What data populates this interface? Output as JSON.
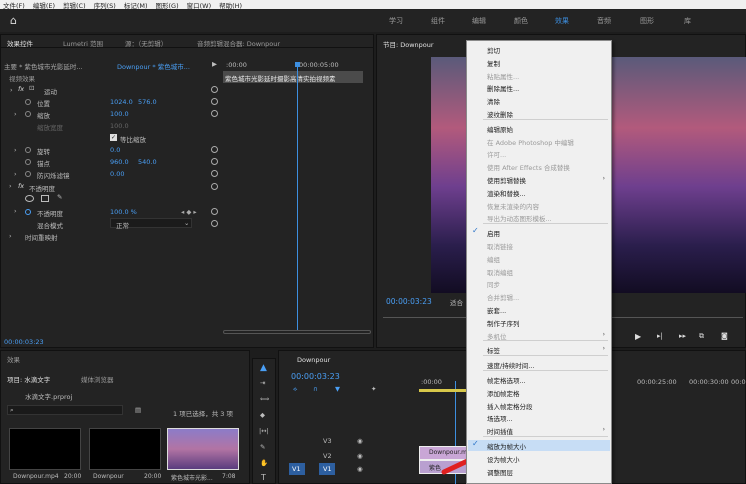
{
  "menubar": [
    "文件(F)",
    "编辑(E)",
    "剪辑(C)",
    "序列(S)",
    "标记(M)",
    "图形(G)",
    "窗口(W)",
    "帮助(H)"
  ],
  "workspaces": [
    "学习",
    "组件",
    "编辑",
    "颜色",
    "效果",
    "音频",
    "图形",
    "库"
  ],
  "active_workspace": "效果",
  "effect_controls": {
    "tabs": [
      "效果控件",
      "Lumetri 范围",
      "源：（无剪辑）",
      "音频剪辑混合器: Downpour"
    ],
    "master": "主要 * 紫色城市光影延时...",
    "seq": "Downpour * 紫色城市...",
    "time_start": ":00:00",
    "time_end": "00:00:05:00",
    "clip_label": "紫色城市光影延时摄影高清实拍视频素",
    "section_video": "视频效果",
    "motion": "运动",
    "position_label": "位置",
    "position_x": "1024.0",
    "position_y": "576.0",
    "scale_label": "缩放",
    "scale_value": "100.0",
    "scale_width_label": "缩放宽度",
    "scale_width_value": "100.0",
    "uniform_label": "等比缩放",
    "rotation_label": "旋转",
    "rotation_value": "0.0",
    "anchor_label": "锚点",
    "anchor_x": "960.0",
    "anchor_y": "540.0",
    "flicker_label": "防闪烁滤镜",
    "flicker_value": "0.00",
    "opacity_section": "不透明度",
    "opacity_label": "不透明度",
    "opacity_value": "100.0 %",
    "blend_label": "混合模式",
    "blend_value": "正常",
    "time_remap": "时间重映射",
    "footer_time": "00:00:03:23"
  },
  "program": {
    "title": "节目: Downpour",
    "timecode": "00:00:03:23",
    "fit": "适合"
  },
  "project": {
    "tab_effects": "效果",
    "tab_project": "项目: 水滴文字",
    "tab_media": "媒体浏览器",
    "file": "水滴文字.prproj",
    "selection": "1 项已选择，共 3 项",
    "items": [
      {
        "name": "Downpour.mp4",
        "dur": "20:00"
      },
      {
        "name": "Downpour",
        "dur": "20:00"
      },
      {
        "name": "紫色城市光影...",
        "dur": "7:08"
      }
    ]
  },
  "timeline": {
    "title": "Downpour",
    "timecode": "00:00:03:23",
    "ruler": [
      ":00:00",
      "00:00:25:00",
      "00:00:30:00",
      "00:00"
    ],
    "tracks": [
      "V3",
      "V2",
      "V1"
    ],
    "src": "V1",
    "clip_a": "Downpour.mp",
    "clip_b": "紫色"
  },
  "context_menu": {
    "items": [
      {
        "label": "剪切",
        "enabled": true
      },
      {
        "label": "复制",
        "enabled": true
      },
      {
        "label": "粘贴属性...",
        "enabled": false
      },
      {
        "label": "删除属性...",
        "enabled": true
      },
      {
        "label": "清除",
        "enabled": true
      },
      {
        "label": "波纹删除",
        "enabled": true
      },
      {
        "label": "编辑原始",
        "enabled": true
      },
      {
        "label": "在 Adobe Photoshop 中编辑",
        "enabled": false
      },
      {
        "label": "许可...",
        "enabled": false
      },
      {
        "label": "使用 After Effects 合成替换",
        "enabled": false
      },
      {
        "label": "使用剪辑替换",
        "enabled": true,
        "submenu": true
      },
      {
        "label": "渲染和替换...",
        "enabled": true
      },
      {
        "label": "恢复未渲染的内容",
        "enabled": false
      },
      {
        "label": "导出为动态图形模板...",
        "enabled": false
      },
      {
        "label": "启用",
        "enabled": true,
        "checked": true
      },
      {
        "label": "取消链接",
        "enabled": false
      },
      {
        "label": "编组",
        "enabled": false
      },
      {
        "label": "取消编组",
        "enabled": false
      },
      {
        "label": "同步",
        "enabled": false
      },
      {
        "label": "合并剪辑...",
        "enabled": false
      },
      {
        "label": "嵌套...",
        "enabled": true
      },
      {
        "label": "制作子序列",
        "enabled": true
      },
      {
        "label": "多机位",
        "enabled": false,
        "submenu": true
      },
      {
        "label": "标签",
        "enabled": true,
        "submenu": true
      },
      {
        "label": "速度/持续时间...",
        "enabled": true
      },
      {
        "label": "帧定格选项...",
        "enabled": true
      },
      {
        "label": "添加帧定格",
        "enabled": true
      },
      {
        "label": "插入帧定格分段",
        "enabled": true
      },
      {
        "label": "场选项...",
        "enabled": true
      },
      {
        "label": "时间插值",
        "enabled": true,
        "submenu": true
      },
      {
        "label": "缩放为帧大小",
        "enabled": true,
        "checked": true,
        "highlight": true
      },
      {
        "label": "设为帧大小",
        "enabled": true
      },
      {
        "label": "调整图层",
        "enabled": true
      }
    ]
  },
  "colors": {
    "accent": "#4a9ff5",
    "playhead": "#3d8fe0",
    "arrow": "#e02020"
  }
}
